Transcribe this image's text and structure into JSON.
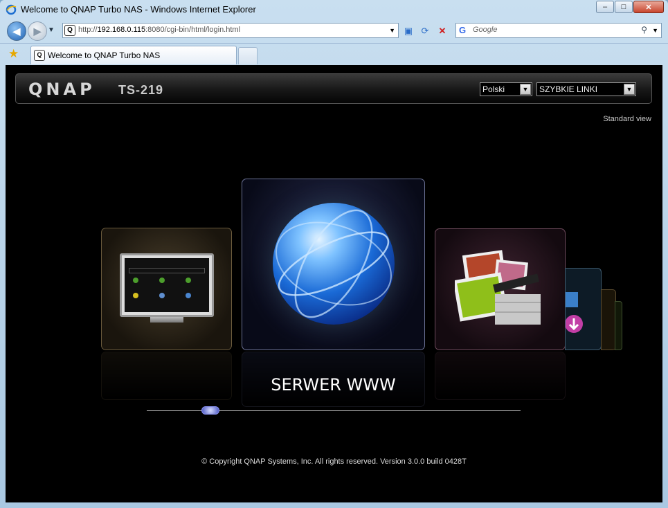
{
  "window": {
    "title": "Welcome to QNAP Turbo NAS - Windows Internet Explorer",
    "buttons": {
      "minimize": "–",
      "maximize": "□",
      "close": "✕"
    }
  },
  "nav": {
    "address_prefix": "http://",
    "address_host": "192.168.0.115",
    "address_rest": ":8080/cgi-bin/html/login.html",
    "search_placeholder": "Google"
  },
  "tabs": [
    {
      "label": "Welcome to QNAP Turbo NAS",
      "active": true
    }
  ],
  "page": {
    "logo": "QNAP",
    "model": "TS-219",
    "language_select": "Polski",
    "quicklinks_select": "SZYBKIE LINKI",
    "standard_view_link": "Standard view",
    "carousel_caption": "SERWER WWW",
    "copyright": "© Copyright QNAP Systems, Inc. All rights reserved. Version 3.0.0 build 0428T"
  },
  "carousel": {
    "tiles": [
      {
        "icon": "monitor-admin-icon"
      },
      {
        "icon": "globe-web-server-icon",
        "selected": true
      },
      {
        "icon": "multimedia-station-icon"
      },
      {
        "icon": "download-station-icon"
      }
    ]
  },
  "colors": {
    "page_background": "#000000",
    "ie_frame": "#bcd6ec"
  }
}
